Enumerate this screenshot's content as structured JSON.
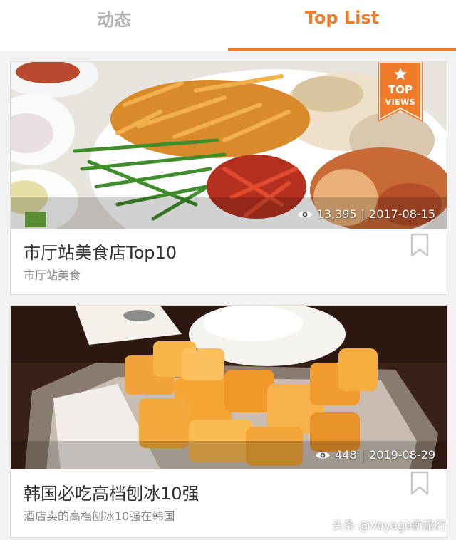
{
  "tabs": [
    {
      "label": "动态"
    },
    {
      "label": "Top List"
    }
  ],
  "accent_color": "#f07b2a",
  "badge": {
    "line1": "TOP",
    "line2": "VIEWS",
    "icon": "star-icon"
  },
  "cards": [
    {
      "title": "市厅站美食店Top10",
      "subtitle": "市厅站美食",
      "views": "13,395",
      "date": "2017-08-15",
      "separator": "|"
    },
    {
      "title": "韩国必吃高档刨冰10强",
      "subtitle": "酒店卖的高档刨冰10强在韩国",
      "views": "448",
      "date": "2019-08-29",
      "separator": "|"
    }
  ],
  "watermark": "头条 @Voyage新旅行"
}
